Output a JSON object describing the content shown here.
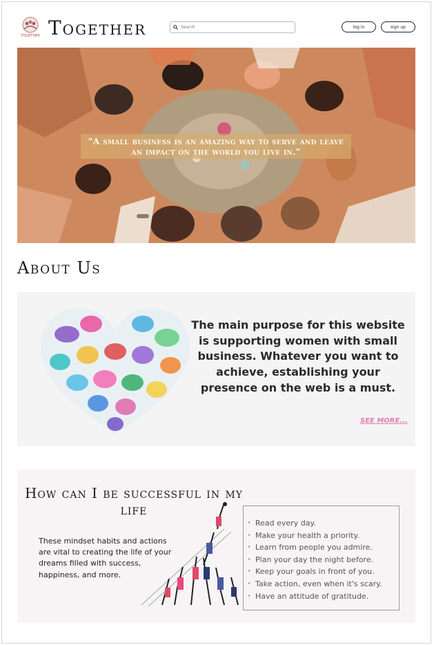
{
  "header": {
    "brand": "Together",
    "logo_text": "TOGETHER",
    "search_placeholder": "Search",
    "login_label": "log in",
    "signup_label": "sign up"
  },
  "hero": {
    "quote": "\"A small business is an amazing way to serve and leave an impact on the world you live in.\""
  },
  "about": {
    "title": "About Us",
    "body": "The main purpose for this website is supporting women with small business. Whatever you want to achieve, establishing your presence on the web is a must.",
    "see_more": "SEE MORE..."
  },
  "success": {
    "title": "How can I be successful in my life",
    "paragraph": "These mindset habits and actions are vital to creating the life of your dreams filled with success, happiness, and more.",
    "tips": [
      "Read every day.",
      "Make your health a priority.",
      "Learn from people you admire.",
      "Plan your day the night before.",
      "Keep your goals in front of you.",
      "Take action, even when it's scary.",
      "Have an attitude of gratitude."
    ]
  },
  "colors": {
    "hero_bg": "#c98556",
    "see_more": "#e07fb2",
    "about_bg": "#f4f4f4",
    "success_bg": "#f8f4f5"
  }
}
